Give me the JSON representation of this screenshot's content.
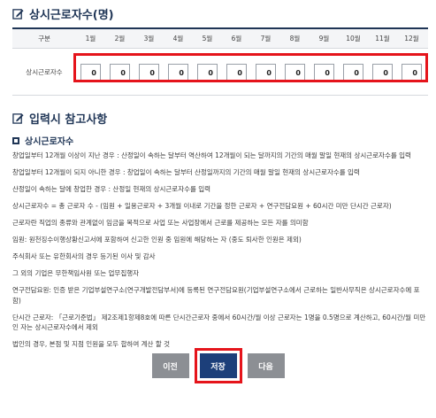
{
  "section1": {
    "title": "상시근로자수(명)"
  },
  "table": {
    "header_label": "구분",
    "months": [
      "1월",
      "2월",
      "3월",
      "4월",
      "5월",
      "6월",
      "7월",
      "8월",
      "9월",
      "10월",
      "11월",
      "12월"
    ],
    "row_label": "상시근로자수",
    "values": [
      "0",
      "0",
      "0",
      "0",
      "0",
      "0",
      "0",
      "0",
      "0",
      "0",
      "0",
      "0"
    ]
  },
  "section2": {
    "title": "입력시 참고사항"
  },
  "notes": {
    "subhead": "상시근로자수",
    "lines": [
      "창업일부터 12개월 이상이 지난 경우 : 산정일이 속하는 달부터 역산하여 12개월이 되는 달까지의 기간의 매월 말일 현재의 상시근로자수를 입력",
      "창업일부터 12개월이 되지 아니한 경우 : 창업일이 속하는 달부터 산정일까지의 기간의 매월 말일 현재의 상시근로자수를 입력",
      "산정일이 속하는 달에 창업한 경우 : 산정일 현재의 상시근로자수를 입력",
      "상시근로자수 = 총 근로자 수 - (임원 + 일용근로자 + 3개월 이내로 기간을 정한 근로자 + 연구전담요원 + 60시간 미만 단시간 근로자)",
      "근로자란 직업의 종류와 관계없이 임금을 목적으로 사업 또는 사업장에서 근로를 제공하는 모든 자를 의미함",
      "임원: 원천징수이행상황신고서에 포함하여 신고한 인원 중 임원에 해당하는 자 (중도 퇴사한 인원은 제외)",
      "주식회사 또는 유한회사의 경우 등기된 이사 및 감사",
      "그 외의 기업은 무한책임사원 또는 업무집행자",
      "연구전담요원: 인증 받은 기업부설연구소(연구개발전담부서)에 등록된 연구전담요원(기업부설연구소에서 근로하는 일반사무직은 상시근로자수에 포함)",
      "단시간 근로자: 「근로기준법」 제2조제1항제8호에 따른 단시간근로자 중에서 60시간/월 이상 근로자는 1명을 0.5명으로 계산하고, 60시간/월 미만인 자는 상시근로자수에서 제외",
      "법인의 경우, 본점 및 지점 인원을 모두 합하여 계산 할 것"
    ]
  },
  "buttons": {
    "prev": "이전",
    "save": "저장",
    "next": "다음"
  },
  "colors": {
    "navy": "#1f3556",
    "primary": "#1c3f7a",
    "highlight": "#e5141b",
    "gray_button": "#8c8f94"
  }
}
